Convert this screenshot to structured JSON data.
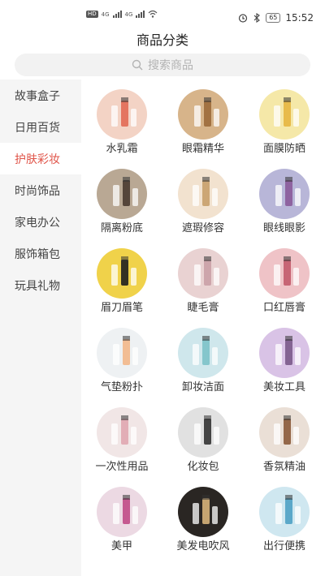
{
  "statusbar": {
    "network_left": "HD",
    "network_right": "HD",
    "net1": "4G",
    "net2": "4G",
    "battery": "65",
    "time": "15:52"
  },
  "title": "商品分类",
  "search": {
    "placeholder": "搜索商品"
  },
  "sidebar": {
    "items": [
      {
        "label": "故事盒子",
        "active": false
      },
      {
        "label": "日用百货",
        "active": false
      },
      {
        "label": "护肤彩妆",
        "active": true
      },
      {
        "label": "时尚饰品",
        "active": false
      },
      {
        "label": "家电办公",
        "active": false
      },
      {
        "label": "服饰箱包",
        "active": false
      },
      {
        "label": "玩具礼物",
        "active": false
      }
    ]
  },
  "categories": [
    {
      "label": "水乳霜",
      "bg": "#f3d3c5",
      "accent": "#e26a54"
    },
    {
      "label": "眼霜精华",
      "bg": "#d7b48a",
      "accent": "#9c6a3a"
    },
    {
      "label": "面膜防晒",
      "bg": "#f5e8a8",
      "accent": "#e7b640"
    },
    {
      "label": "隔离粉底",
      "bg": "#b9a894",
      "accent": "#4a3a30"
    },
    {
      "label": "遮瑕修容",
      "bg": "#f2e2cf",
      "accent": "#c8a06a"
    },
    {
      "label": "眼线眼影",
      "bg": "#b8b6d8",
      "accent": "#8a5a9a"
    },
    {
      "label": "眉刀眉笔",
      "bg": "#f0d24a",
      "accent": "#1f1f1f"
    },
    {
      "label": "睫毛膏",
      "bg": "#e9d2d2",
      "accent": "#caa0a6"
    },
    {
      "label": "口红唇膏",
      "bg": "#efc3c7",
      "accent": "#c25b6c"
    },
    {
      "label": "气垫粉扑",
      "bg": "#eef1f3",
      "accent": "#f2b78a"
    },
    {
      "label": "卸妆洁面",
      "bg": "#cfe7ec",
      "accent": "#7cc2c9"
    },
    {
      "label": "美妆工具",
      "bg": "#d9c3e6",
      "accent": "#7a5a8a"
    },
    {
      "label": "一次性用品",
      "bg": "#f1e6e6",
      "accent": "#e0a6b0"
    },
    {
      "label": "化妆包",
      "bg": "#e1e1e1",
      "accent": "#333333"
    },
    {
      "label": "香氛精油",
      "bg": "#eadfd6",
      "accent": "#8b5a3a"
    },
    {
      "label": "美甲",
      "bg": "#ecd9e3",
      "accent": "#c14a86"
    },
    {
      "label": "美发电吹风",
      "bg": "#2a2623",
      "accent": "#d6b37a"
    },
    {
      "label": "出行便携",
      "bg": "#cfe7f0",
      "accent": "#4ea1c4"
    }
  ]
}
